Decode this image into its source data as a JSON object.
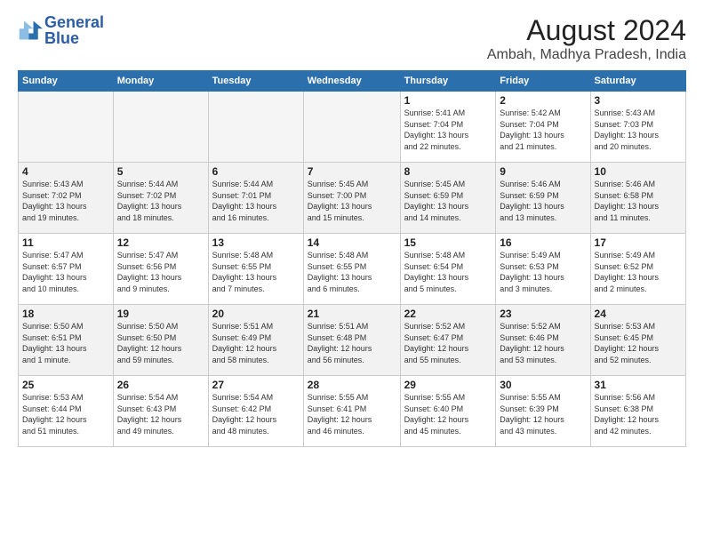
{
  "logo": {
    "line1": "General",
    "line2": "Blue"
  },
  "title": "August 2024",
  "subtitle": "Ambah, Madhya Pradesh, India",
  "days_of_week": [
    "Sunday",
    "Monday",
    "Tuesday",
    "Wednesday",
    "Thursday",
    "Friday",
    "Saturday"
  ],
  "weeks": [
    [
      {
        "num": "",
        "info": ""
      },
      {
        "num": "",
        "info": ""
      },
      {
        "num": "",
        "info": ""
      },
      {
        "num": "",
        "info": ""
      },
      {
        "num": "1",
        "info": "Sunrise: 5:41 AM\nSunset: 7:04 PM\nDaylight: 13 hours\nand 22 minutes."
      },
      {
        "num": "2",
        "info": "Sunrise: 5:42 AM\nSunset: 7:04 PM\nDaylight: 13 hours\nand 21 minutes."
      },
      {
        "num": "3",
        "info": "Sunrise: 5:43 AM\nSunset: 7:03 PM\nDaylight: 13 hours\nand 20 minutes."
      }
    ],
    [
      {
        "num": "4",
        "info": "Sunrise: 5:43 AM\nSunset: 7:02 PM\nDaylight: 13 hours\nand 19 minutes."
      },
      {
        "num": "5",
        "info": "Sunrise: 5:44 AM\nSunset: 7:02 PM\nDaylight: 13 hours\nand 18 minutes."
      },
      {
        "num": "6",
        "info": "Sunrise: 5:44 AM\nSunset: 7:01 PM\nDaylight: 13 hours\nand 16 minutes."
      },
      {
        "num": "7",
        "info": "Sunrise: 5:45 AM\nSunset: 7:00 PM\nDaylight: 13 hours\nand 15 minutes."
      },
      {
        "num": "8",
        "info": "Sunrise: 5:45 AM\nSunset: 6:59 PM\nDaylight: 13 hours\nand 14 minutes."
      },
      {
        "num": "9",
        "info": "Sunrise: 5:46 AM\nSunset: 6:59 PM\nDaylight: 13 hours\nand 13 minutes."
      },
      {
        "num": "10",
        "info": "Sunrise: 5:46 AM\nSunset: 6:58 PM\nDaylight: 13 hours\nand 11 minutes."
      }
    ],
    [
      {
        "num": "11",
        "info": "Sunrise: 5:47 AM\nSunset: 6:57 PM\nDaylight: 13 hours\nand 10 minutes."
      },
      {
        "num": "12",
        "info": "Sunrise: 5:47 AM\nSunset: 6:56 PM\nDaylight: 13 hours\nand 9 minutes."
      },
      {
        "num": "13",
        "info": "Sunrise: 5:48 AM\nSunset: 6:55 PM\nDaylight: 13 hours\nand 7 minutes."
      },
      {
        "num": "14",
        "info": "Sunrise: 5:48 AM\nSunset: 6:55 PM\nDaylight: 13 hours\nand 6 minutes."
      },
      {
        "num": "15",
        "info": "Sunrise: 5:48 AM\nSunset: 6:54 PM\nDaylight: 13 hours\nand 5 minutes."
      },
      {
        "num": "16",
        "info": "Sunrise: 5:49 AM\nSunset: 6:53 PM\nDaylight: 13 hours\nand 3 minutes."
      },
      {
        "num": "17",
        "info": "Sunrise: 5:49 AM\nSunset: 6:52 PM\nDaylight: 13 hours\nand 2 minutes."
      }
    ],
    [
      {
        "num": "18",
        "info": "Sunrise: 5:50 AM\nSunset: 6:51 PM\nDaylight: 13 hours\nand 1 minute."
      },
      {
        "num": "19",
        "info": "Sunrise: 5:50 AM\nSunset: 6:50 PM\nDaylight: 12 hours\nand 59 minutes."
      },
      {
        "num": "20",
        "info": "Sunrise: 5:51 AM\nSunset: 6:49 PM\nDaylight: 12 hours\nand 58 minutes."
      },
      {
        "num": "21",
        "info": "Sunrise: 5:51 AM\nSunset: 6:48 PM\nDaylight: 12 hours\nand 56 minutes."
      },
      {
        "num": "22",
        "info": "Sunrise: 5:52 AM\nSunset: 6:47 PM\nDaylight: 12 hours\nand 55 minutes."
      },
      {
        "num": "23",
        "info": "Sunrise: 5:52 AM\nSunset: 6:46 PM\nDaylight: 12 hours\nand 53 minutes."
      },
      {
        "num": "24",
        "info": "Sunrise: 5:53 AM\nSunset: 6:45 PM\nDaylight: 12 hours\nand 52 minutes."
      }
    ],
    [
      {
        "num": "25",
        "info": "Sunrise: 5:53 AM\nSunset: 6:44 PM\nDaylight: 12 hours\nand 51 minutes."
      },
      {
        "num": "26",
        "info": "Sunrise: 5:54 AM\nSunset: 6:43 PM\nDaylight: 12 hours\nand 49 minutes."
      },
      {
        "num": "27",
        "info": "Sunrise: 5:54 AM\nSunset: 6:42 PM\nDaylight: 12 hours\nand 48 minutes."
      },
      {
        "num": "28",
        "info": "Sunrise: 5:55 AM\nSunset: 6:41 PM\nDaylight: 12 hours\nand 46 minutes."
      },
      {
        "num": "29",
        "info": "Sunrise: 5:55 AM\nSunset: 6:40 PM\nDaylight: 12 hours\nand 45 minutes."
      },
      {
        "num": "30",
        "info": "Sunrise: 5:55 AM\nSunset: 6:39 PM\nDaylight: 12 hours\nand 43 minutes."
      },
      {
        "num": "31",
        "info": "Sunrise: 5:56 AM\nSunset: 6:38 PM\nDaylight: 12 hours\nand 42 minutes."
      }
    ]
  ]
}
